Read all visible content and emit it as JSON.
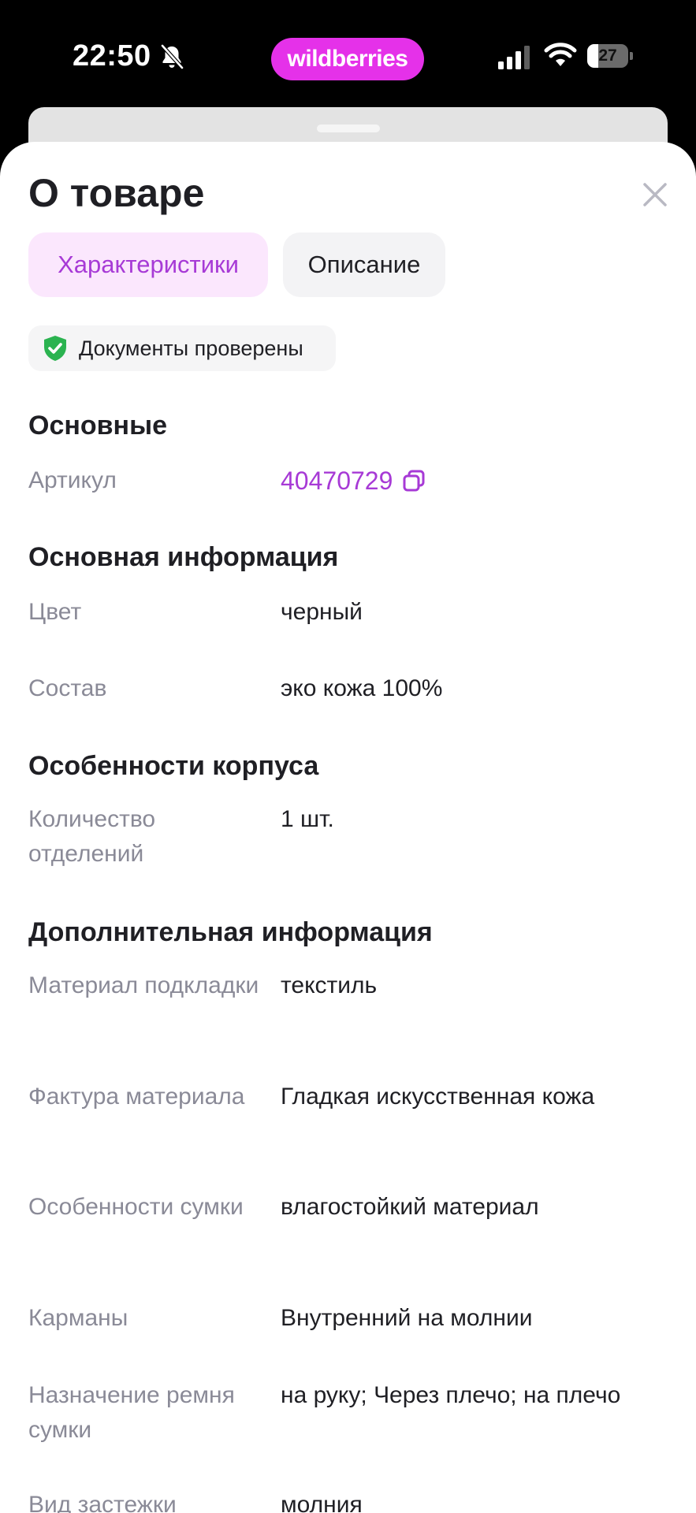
{
  "status_bar": {
    "time": "22:50",
    "brand": "wildberries",
    "battery": "27",
    "battery_level": 0.27,
    "icons": [
      "bell-slash-icon",
      "signal-icon",
      "wifi-icon",
      "battery-icon"
    ]
  },
  "sheet": {
    "title": "О товаре",
    "close_icon": "close-icon"
  },
  "tabs": [
    {
      "label": "Характеристики",
      "active": true
    },
    {
      "label": "Описание",
      "active": false
    }
  ],
  "badge": {
    "text": "Документы проверены",
    "icon": "shield-check-icon"
  },
  "sections": {
    "main": {
      "title": "Основные",
      "article_label": "Артикул",
      "article_value": "40470729"
    },
    "basic_info": {
      "title": "Основная информация",
      "rows": [
        {
          "label": "Цвет",
          "value": "черный"
        },
        {
          "label": "Состав",
          "value": "эко кожа 100%"
        }
      ]
    },
    "body": {
      "title": "Особенности корпуса",
      "rows": [
        {
          "label": "Количество отделений",
          "value": "1 шт."
        }
      ]
    },
    "extra": {
      "title": "Дополнительная информация",
      "rows": [
        {
          "label": "Материал подкладки",
          "value": "текстиль"
        },
        {
          "label": "Фактура материала",
          "value": "Гладкая искусственная кожа"
        },
        {
          "label": "Особенности сумки",
          "value": "влагостойкий материал"
        },
        {
          "label": "Карманы",
          "value": "Внутренний на молнии"
        },
        {
          "label": "Назначение ремня сумки",
          "value": "на руку; Через плечо; на плечо"
        },
        {
          "label": "Вид застежки",
          "value": "молния"
        }
      ]
    }
  },
  "colors": {
    "accent": "#a73ad6",
    "brand": "#e531e9",
    "active_tab_bg": "#fbe7fd",
    "label_gray": "#8a8a97",
    "text": "#1f1f24",
    "shield_green": "#2bb350"
  }
}
